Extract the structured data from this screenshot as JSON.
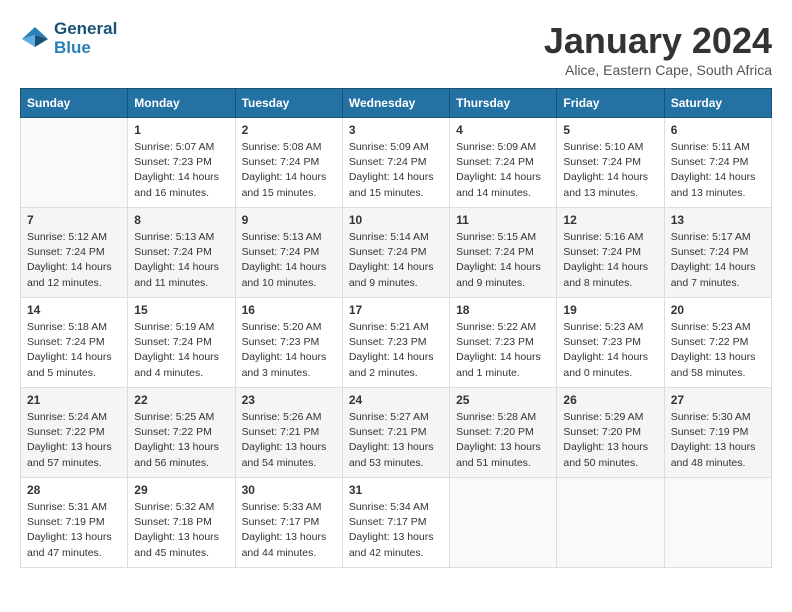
{
  "logo": {
    "line1": "General",
    "line2": "Blue"
  },
  "title": "January 2024",
  "location": "Alice, Eastern Cape, South Africa",
  "days_header": [
    "Sunday",
    "Monday",
    "Tuesday",
    "Wednesday",
    "Thursday",
    "Friday",
    "Saturday"
  ],
  "weeks": [
    [
      {
        "day": "",
        "info": ""
      },
      {
        "day": "1",
        "info": "Sunrise: 5:07 AM\nSunset: 7:23 PM\nDaylight: 14 hours\nand 16 minutes."
      },
      {
        "day": "2",
        "info": "Sunrise: 5:08 AM\nSunset: 7:24 PM\nDaylight: 14 hours\nand 15 minutes."
      },
      {
        "day": "3",
        "info": "Sunrise: 5:09 AM\nSunset: 7:24 PM\nDaylight: 14 hours\nand 15 minutes."
      },
      {
        "day": "4",
        "info": "Sunrise: 5:09 AM\nSunset: 7:24 PM\nDaylight: 14 hours\nand 14 minutes."
      },
      {
        "day": "5",
        "info": "Sunrise: 5:10 AM\nSunset: 7:24 PM\nDaylight: 14 hours\nand 13 minutes."
      },
      {
        "day": "6",
        "info": "Sunrise: 5:11 AM\nSunset: 7:24 PM\nDaylight: 14 hours\nand 13 minutes."
      }
    ],
    [
      {
        "day": "7",
        "info": "Sunrise: 5:12 AM\nSunset: 7:24 PM\nDaylight: 14 hours\nand 12 minutes."
      },
      {
        "day": "8",
        "info": "Sunrise: 5:13 AM\nSunset: 7:24 PM\nDaylight: 14 hours\nand 11 minutes."
      },
      {
        "day": "9",
        "info": "Sunrise: 5:13 AM\nSunset: 7:24 PM\nDaylight: 14 hours\nand 10 minutes."
      },
      {
        "day": "10",
        "info": "Sunrise: 5:14 AM\nSunset: 7:24 PM\nDaylight: 14 hours\nand 9 minutes."
      },
      {
        "day": "11",
        "info": "Sunrise: 5:15 AM\nSunset: 7:24 PM\nDaylight: 14 hours\nand 9 minutes."
      },
      {
        "day": "12",
        "info": "Sunrise: 5:16 AM\nSunset: 7:24 PM\nDaylight: 14 hours\nand 8 minutes."
      },
      {
        "day": "13",
        "info": "Sunrise: 5:17 AM\nSunset: 7:24 PM\nDaylight: 14 hours\nand 7 minutes."
      }
    ],
    [
      {
        "day": "14",
        "info": "Sunrise: 5:18 AM\nSunset: 7:24 PM\nDaylight: 14 hours\nand 5 minutes."
      },
      {
        "day": "15",
        "info": "Sunrise: 5:19 AM\nSunset: 7:24 PM\nDaylight: 14 hours\nand 4 minutes."
      },
      {
        "day": "16",
        "info": "Sunrise: 5:20 AM\nSunset: 7:23 PM\nDaylight: 14 hours\nand 3 minutes."
      },
      {
        "day": "17",
        "info": "Sunrise: 5:21 AM\nSunset: 7:23 PM\nDaylight: 14 hours\nand 2 minutes."
      },
      {
        "day": "18",
        "info": "Sunrise: 5:22 AM\nSunset: 7:23 PM\nDaylight: 14 hours\nand 1 minute."
      },
      {
        "day": "19",
        "info": "Sunrise: 5:23 AM\nSunset: 7:23 PM\nDaylight: 14 hours\nand 0 minutes."
      },
      {
        "day": "20",
        "info": "Sunrise: 5:23 AM\nSunset: 7:22 PM\nDaylight: 13 hours\nand 58 minutes."
      }
    ],
    [
      {
        "day": "21",
        "info": "Sunrise: 5:24 AM\nSunset: 7:22 PM\nDaylight: 13 hours\nand 57 minutes."
      },
      {
        "day": "22",
        "info": "Sunrise: 5:25 AM\nSunset: 7:22 PM\nDaylight: 13 hours\nand 56 minutes."
      },
      {
        "day": "23",
        "info": "Sunrise: 5:26 AM\nSunset: 7:21 PM\nDaylight: 13 hours\nand 54 minutes."
      },
      {
        "day": "24",
        "info": "Sunrise: 5:27 AM\nSunset: 7:21 PM\nDaylight: 13 hours\nand 53 minutes."
      },
      {
        "day": "25",
        "info": "Sunrise: 5:28 AM\nSunset: 7:20 PM\nDaylight: 13 hours\nand 51 minutes."
      },
      {
        "day": "26",
        "info": "Sunrise: 5:29 AM\nSunset: 7:20 PM\nDaylight: 13 hours\nand 50 minutes."
      },
      {
        "day": "27",
        "info": "Sunrise: 5:30 AM\nSunset: 7:19 PM\nDaylight: 13 hours\nand 48 minutes."
      }
    ],
    [
      {
        "day": "28",
        "info": "Sunrise: 5:31 AM\nSunset: 7:19 PM\nDaylight: 13 hours\nand 47 minutes."
      },
      {
        "day": "29",
        "info": "Sunrise: 5:32 AM\nSunset: 7:18 PM\nDaylight: 13 hours\nand 45 minutes."
      },
      {
        "day": "30",
        "info": "Sunrise: 5:33 AM\nSunset: 7:17 PM\nDaylight: 13 hours\nand 44 minutes."
      },
      {
        "day": "31",
        "info": "Sunrise: 5:34 AM\nSunset: 7:17 PM\nDaylight: 13 hours\nand 42 minutes."
      },
      {
        "day": "",
        "info": ""
      },
      {
        "day": "",
        "info": ""
      },
      {
        "day": "",
        "info": ""
      }
    ]
  ]
}
